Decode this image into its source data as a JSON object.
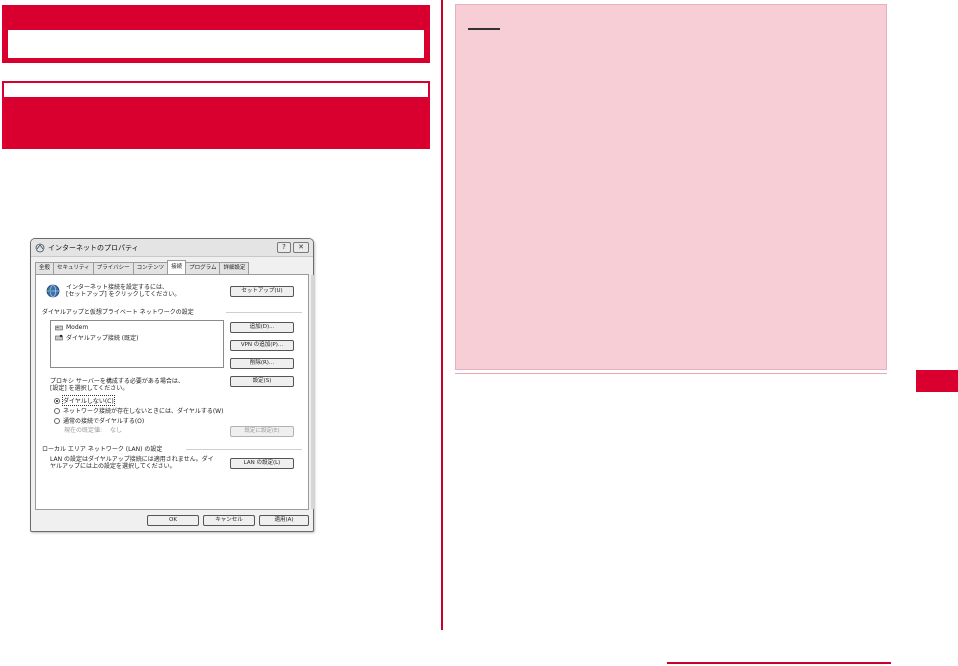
{
  "dialog": {
    "title": "インターネットのプロパティ",
    "help_label": "?",
    "close_label": "✕",
    "tabs": [
      {
        "label": "全般"
      },
      {
        "label": "セキュリティ"
      },
      {
        "label": "プライバシー"
      },
      {
        "label": "コンテンツ"
      },
      {
        "label": "接続"
      },
      {
        "label": "プログラム"
      },
      {
        "label": "詳細設定"
      }
    ],
    "active_tab": "接続",
    "setup": {
      "line1": "インターネット接続を設定するには、",
      "line2": "[セットアップ] をクリックしてください。",
      "button": "セットアップ(U)"
    },
    "dialup": {
      "heading": "ダイヤルアップと仮想プライベート ネットワークの設定",
      "items": [
        "Modem",
        "ダイヤルアップ接続 (既定)"
      ],
      "add_button": "追加(D)...",
      "add_vpn_button": "VPN の追加(P)...",
      "remove_button": "削除(R)...",
      "settings_button": "設定(S)",
      "proxy_line1": "プロキシ サーバーを構成する必要がある場合は、",
      "proxy_line2": "[設定] を選択してください。",
      "options": [
        {
          "label": "ダイヤルしない(C)",
          "selected": true
        },
        {
          "label": "ネットワーク接続が存在しないときには、ダイヤルする(W)",
          "selected": false
        },
        {
          "label": "通常の接続でダイヤルする(O)",
          "selected": false
        }
      ],
      "current_default_label": "現在の既定値:",
      "current_default_value": "なし",
      "set_default_button": "既定に設定(E)"
    },
    "lan": {
      "heading": "ローカル エリア ネットワーク (LAN) の設定",
      "line1": "LAN の設定はダイヤルアップ接続には適用されません。ダイ",
      "line2": "ヤルアップには上の設定を選択してください。",
      "button": "LAN の設定(L)"
    },
    "footer": {
      "ok": "OK",
      "cancel": "キャンセル",
      "apply": "適用(A)"
    }
  },
  "colors": {
    "accent_red": "#d9002f",
    "note_pink": "#f7cdd6"
  }
}
